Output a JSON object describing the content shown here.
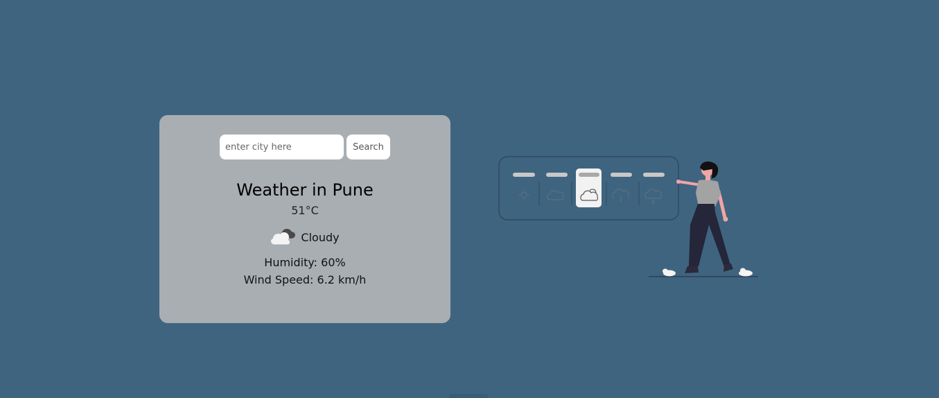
{
  "search": {
    "placeholder": "enter city here",
    "value": "",
    "button_label": "Search"
  },
  "weather": {
    "title": "Weather in Pune",
    "temperature": "51°C",
    "description": "Cloudy",
    "description_icon": "cloud-icon",
    "humidity": "Humidity: 60%",
    "wind_speed": "Wind Speed: 6.2 km/h"
  },
  "illustration": {
    "panel_icons": [
      "sun-cloud-icon",
      "cloud-icon",
      "cloud-sun-icon",
      "cloud-rain-icon",
      "cloud-storm-icon"
    ],
    "selected_index": 2
  },
  "colors": {
    "background": "#3f6480",
    "card": "#a9aeb3",
    "input": "#ffffff"
  }
}
